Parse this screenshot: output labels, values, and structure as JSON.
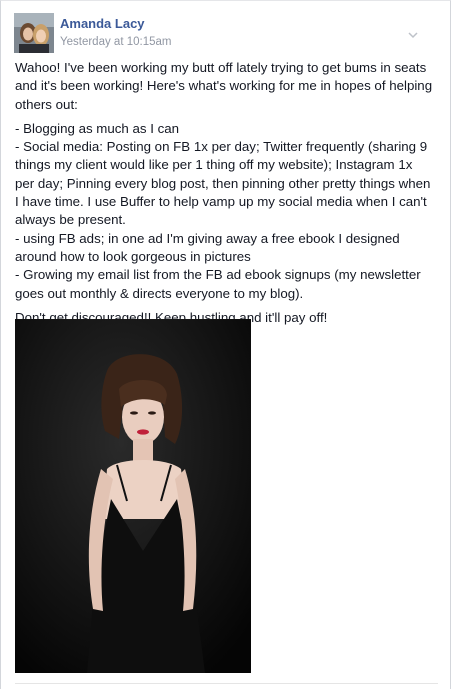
{
  "post": {
    "author": "Amanda Lacy",
    "timestamp": "Yesterday at 10:15am",
    "intro": "Wahoo! I've been working my butt off lately trying to get bums in seats and it's been working! Here's what's working for me in hopes of helping others out:",
    "list": [
      "- Blogging as much as I can",
      "- Social media: Posting on FB 1x per day; Twitter frequently (sharing 9 things my client would like per 1 thing off my website); Instagram 1x per day; Pinning every blog post, then pinning other pretty things when I have time. I use Buffer to help vamp up my social media when I can't always be present.",
      "- using FB ads; in one ad I'm giving away a free ebook I designed around how to look gorgeous in pictures",
      "- Growing my email list from the FB ad ebook signups (my newsletter goes out monthly & directs everyone to my blog)."
    ],
    "closing": "Don't get discouraged!! Keep hustling and it'll pay off!"
  },
  "colors": {
    "author_link": "#3b5998",
    "text": "#141823",
    "meta": "#9197a3"
  },
  "icons": {
    "menu": "chevron-down-icon"
  }
}
